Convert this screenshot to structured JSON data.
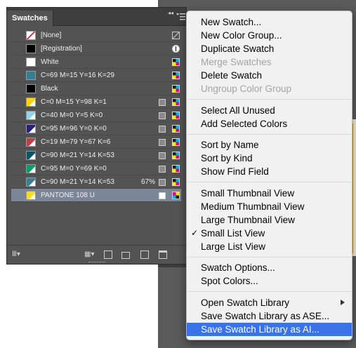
{
  "panel": {
    "title": "Swatches",
    "swatches": [
      {
        "name": "[None]",
        "color": "none",
        "mode": "none"
      },
      {
        "name": "[Registration]",
        "color": "#000000",
        "mode": "registration"
      },
      {
        "name": "White",
        "color": "#ffffff",
        "mode": "cmyk"
      },
      {
        "name": "C=69 M=15 Y=16 K=29",
        "color": "#357b93",
        "mode": "cmyk"
      },
      {
        "name": "Black",
        "color": "#000000",
        "mode": "cmyk"
      },
      {
        "name": "C=0 M=15 Y=98 K=1",
        "color": "#fed300",
        "mode": "cmyk",
        "global": true
      },
      {
        "name": "C=40 M=0 Y=5 K=0",
        "color": "#8fd4e8",
        "mode": "cmyk",
        "global": true
      },
      {
        "name": "C=95 M=96 Y=0 K=0",
        "color": "#2a1f7a",
        "mode": "cmyk",
        "global": true
      },
      {
        "name": "C=19 M=79 Y=67 K=6",
        "color": "#c0404a",
        "mode": "cmyk",
        "global": true
      },
      {
        "name": "C=90 M=21 Y=14 K=53",
        "color": "#0b5468",
        "mode": "cmyk",
        "global": true
      },
      {
        "name": "C=95 M=0 Y=69 K=0",
        "color": "#0a9c6a",
        "mode": "cmyk",
        "global": true
      },
      {
        "name": "C=90 M=21 Y=14 K=53",
        "color": "#3c7f8e",
        "mode": "cmyk",
        "global": true,
        "tint": "67%"
      },
      {
        "name": "PANTONE 108 U",
        "color": "#f9dc1f",
        "mode": "spot",
        "spot": true,
        "selected": true
      }
    ]
  },
  "menu": {
    "items": [
      {
        "label": "New Swatch..."
      },
      {
        "label": "New Color Group..."
      },
      {
        "label": "Duplicate Swatch"
      },
      {
        "label": "Merge Swatches",
        "disabled": true
      },
      {
        "label": "Delete Swatch"
      },
      {
        "label": "Ungroup Color Group",
        "disabled": true
      },
      {
        "label": "Select All Unused",
        "sep_before": true
      },
      {
        "label": "Add Selected Colors"
      },
      {
        "label": "Sort by Name",
        "sep_before": true
      },
      {
        "label": "Sort by Kind"
      },
      {
        "label": "Show Find Field"
      },
      {
        "label": "Small Thumbnail View",
        "sep_before": true
      },
      {
        "label": "Medium Thumbnail View"
      },
      {
        "label": "Large Thumbnail View"
      },
      {
        "label": "Small List View",
        "checked": true
      },
      {
        "label": "Large List View"
      },
      {
        "label": "Swatch Options...",
        "sep_before": true
      },
      {
        "label": "Spot Colors..."
      },
      {
        "label": "Open Swatch Library",
        "sep_before": true,
        "submenu": true
      },
      {
        "label": "Save Swatch Library as ASE..."
      },
      {
        "label": "Save Swatch Library as AI...",
        "highlighted": true
      }
    ]
  }
}
